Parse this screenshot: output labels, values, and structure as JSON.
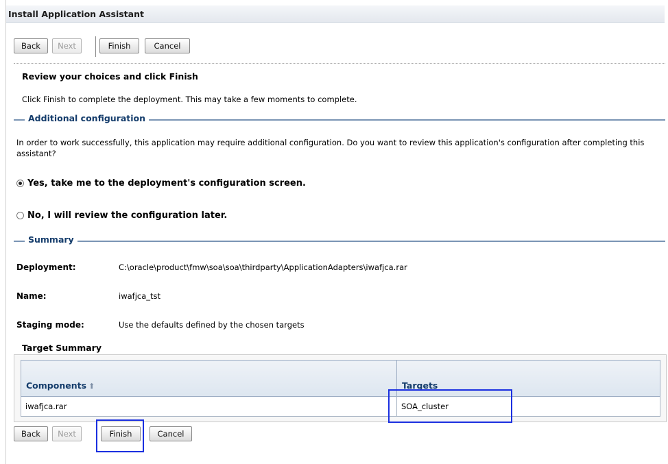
{
  "window": {
    "title": "Install Application Assistant"
  },
  "toolbar_top": {
    "back": "Back",
    "next": "Next",
    "finish": "Finish",
    "cancel": "Cancel"
  },
  "toolbar_bottom": {
    "back": "Back",
    "next": "Next",
    "finish": "Finish",
    "cancel": "Cancel"
  },
  "review": {
    "heading": "Review your choices and click Finish",
    "intro": "Click Finish to complete the deployment. This may take a few moments to complete."
  },
  "additional_config": {
    "title": "Additional configuration",
    "text": "In order to work successfully, this application may require additional configuration. Do you want to review this application's configuration after completing this assistant?",
    "option_yes": "Yes, take me to the deployment's configuration screen.",
    "option_no": "No, I will review the configuration later.",
    "selected": "yes"
  },
  "summary": {
    "title": "Summary",
    "deployment_label": "Deployment:",
    "deployment_value": "C:\\oracle\\product\\fmw\\soa\\soa\\thirdparty\\ApplicationAdapters\\iwafjca.rar",
    "name_label": "Name:",
    "name_value": "iwafjca_tst",
    "staging_label": "Staging mode:",
    "staging_value": "Use the defaults defined by the chosen targets"
  },
  "target_summary": {
    "title": "Target Summary",
    "columns": [
      "Components",
      "Targets"
    ],
    "rows": [
      {
        "component": "iwafjca.rar",
        "target": "SOA_cluster"
      }
    ]
  },
  "icons": {
    "sort": "sort-ascending-icon",
    "radio_on": "radio-selected-icon",
    "radio_off": "radio-unselected-icon"
  },
  "colors": {
    "section_title": "#143c6b",
    "section_rule": "#7a94b4",
    "highlight": "#1a2fe0"
  }
}
